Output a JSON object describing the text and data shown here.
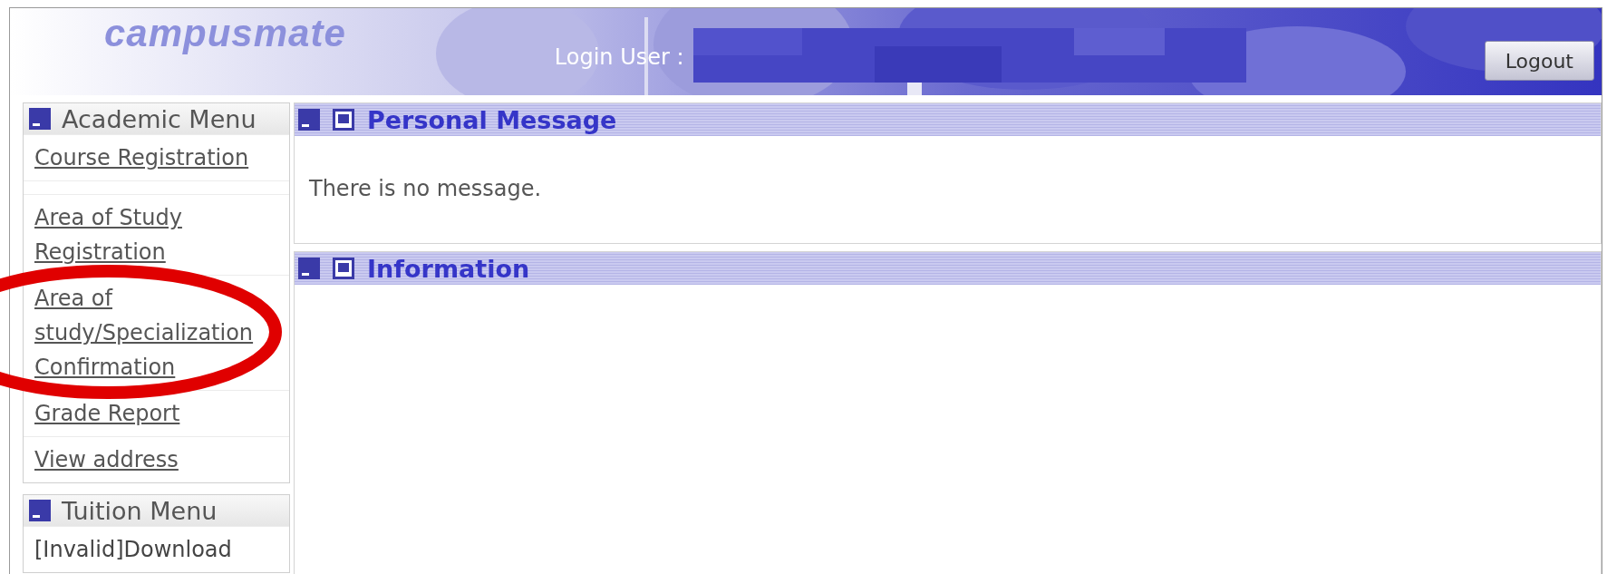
{
  "header": {
    "logo": "campusmate",
    "login_label": "Login User :",
    "logout_button": "Logout"
  },
  "sidebar": {
    "menus": [
      {
        "title": "Academic Menu",
        "expanded": true,
        "items": [
          {
            "kind": "link",
            "label": "Course Registration",
            "disabled": false
          },
          {
            "kind": "spacer"
          },
          {
            "kind": "link",
            "label": "Area of Study Registration",
            "disabled": false
          },
          {
            "kind": "link",
            "label": "Area of study/Specialization Confirmation",
            "disabled": false
          },
          {
            "kind": "link",
            "label": "Grade Report",
            "disabled": false
          },
          {
            "kind": "link",
            "label": "View address",
            "disabled": false
          }
        ]
      },
      {
        "title": "Tuition Menu",
        "expanded": true,
        "items": [
          {
            "kind": "link",
            "label": "[Invalid]Download",
            "disabled": true
          }
        ]
      }
    ]
  },
  "panels": [
    {
      "title": "Personal Message",
      "expanded": true,
      "message": "There is no message."
    },
    {
      "title": "Information",
      "expanded": true
    }
  ],
  "annotation": {
    "kind": "ellipse",
    "color": "#e00000"
  }
}
